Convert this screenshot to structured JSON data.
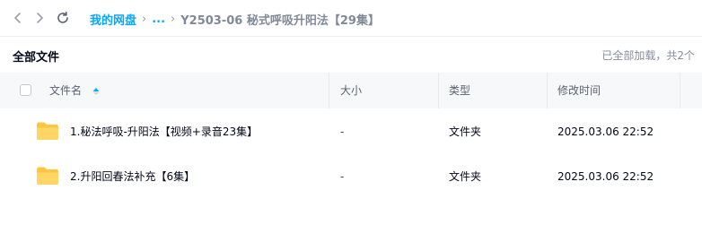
{
  "breadcrumb": {
    "root": "我的网盘",
    "ellipsis": "...",
    "current": "Y2503-06 秘式呼吸升阳法【29集】"
  },
  "toolbar": {
    "title": "全部文件",
    "status": "已全部加载，共2个"
  },
  "table": {
    "columns": {
      "name": "文件名",
      "size": "大小",
      "type": "类型",
      "modified": "修改时间"
    },
    "sort": "name-ascending",
    "rows": [
      {
        "icon": "folder-icon",
        "name": "1.秘法呼吸-升阳法【视频+录音23集】",
        "size": "-",
        "type": "文件夹",
        "modified": "2025.03.06 22:52"
      },
      {
        "icon": "folder-icon",
        "name": "2.升阳回春法补充【6集】",
        "size": "-",
        "type": "文件夹",
        "modified": "2025.03.06 22:52"
      }
    ]
  },
  "colors": {
    "accent": "#06a7ff",
    "folder": "#ffc53d",
    "header_bg": "#f7f8fa"
  }
}
